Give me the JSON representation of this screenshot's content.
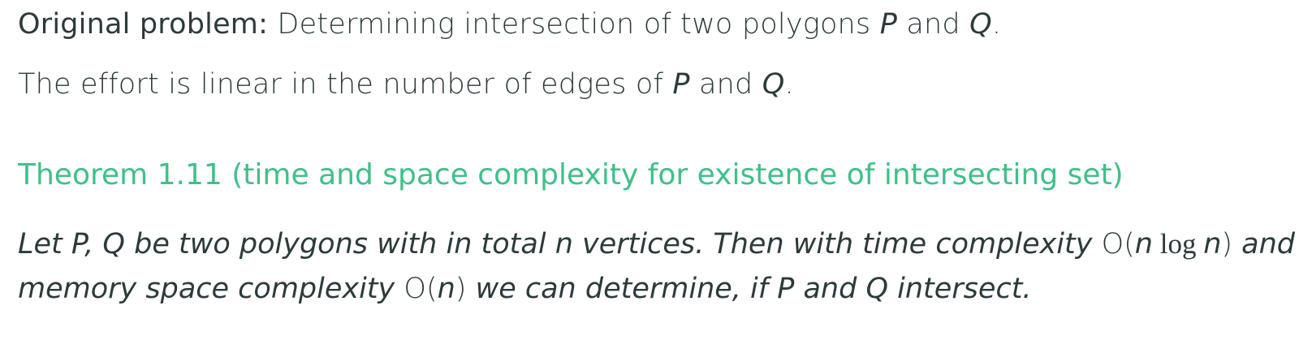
{
  "intro": {
    "label": "Original problem:",
    "text_before_p": " Determining intersection of two polygons ",
    "p": "P",
    "and": " and ",
    "q": "Q",
    "period": "."
  },
  "effort": {
    "text_before_p": "The effort is linear in the number of edges of ",
    "p": "P",
    "and": " and ",
    "q": "Q",
    "period": "."
  },
  "theorem": {
    "heading": "Theorem 1.11 (time and space complexity for existence of intersecting set)",
    "line1": {
      "let": "Let ",
      "pq": "P, Q",
      "mid1": " be two polygons with in total ",
      "n1": "n",
      "mid2": " vertices. Then with time complexity ",
      "O": "O",
      "paren_open": "(",
      "n2": "n",
      "log": " log ",
      "n3": "n",
      "paren_close": ")",
      "and": " and"
    },
    "line2": {
      "start": "memory space complexity ",
      "O": "O",
      "paren_open": "(",
      "n": "n",
      "paren_close": ")",
      "mid": " we can determine, if ",
      "p": "P",
      "and": " and ",
      "q": "Q",
      "end": " intersect."
    }
  }
}
